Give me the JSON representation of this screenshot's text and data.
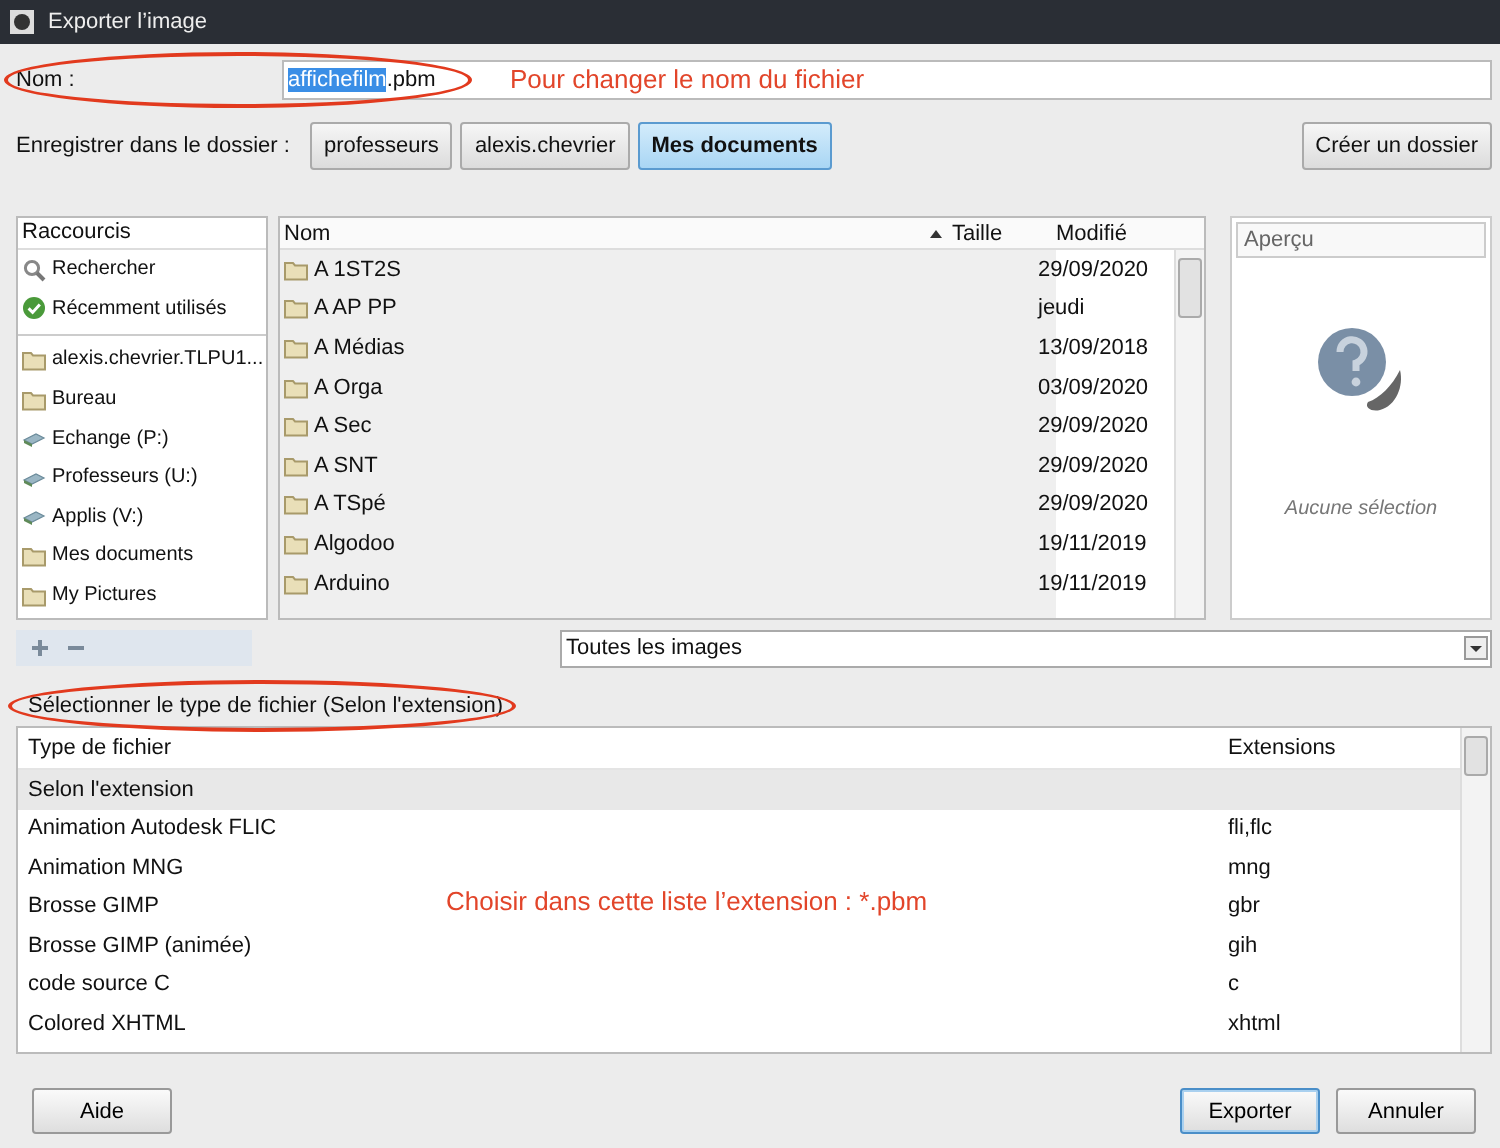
{
  "window": {
    "title": "Exporter l’image"
  },
  "name_field": {
    "label": "Nom :",
    "value_selected": "affichefilm",
    "value_rest": ".pbm",
    "annotation": "Pour changer le nom du fichier"
  },
  "save_in": {
    "label": "Enregistrer dans le dossier :",
    "path": [
      {
        "label": "professeurs",
        "selected": false
      },
      {
        "label": "alexis.chevrier",
        "selected": false
      },
      {
        "label": "Mes documents",
        "selected": true
      }
    ],
    "create_button": "Créer un dossier"
  },
  "sidebar": {
    "header": "Raccourcis",
    "groups": [
      [
        {
          "label": "Rechercher",
          "kind": "search"
        },
        {
          "label": "Récemment utilisés",
          "kind": "recent"
        }
      ],
      [
        {
          "label": "alexis.chevrier.TLPU1...",
          "kind": "folder"
        },
        {
          "label": "Bureau",
          "kind": "folder"
        },
        {
          "label": "Echange (P:)",
          "kind": "drive"
        },
        {
          "label": "Professeurs (U:)",
          "kind": "drive"
        },
        {
          "label": "Applis (V:)",
          "kind": "drive"
        },
        {
          "label": "Mes documents",
          "kind": "folder"
        },
        {
          "label": "My Pictures",
          "kind": "folder"
        }
      ]
    ]
  },
  "files": {
    "columns": [
      "Nom",
      "Taille",
      "Modifié"
    ],
    "rows": [
      {
        "name": "A 1ST2S",
        "modified": "29/09/2020"
      },
      {
        "name": "A AP PP",
        "modified": "jeudi"
      },
      {
        "name": "A Médias",
        "modified": "13/09/2018"
      },
      {
        "name": "A Orga",
        "modified": "03/09/2020"
      },
      {
        "name": "A Sec",
        "modified": "29/09/2020"
      },
      {
        "name": "A SNT",
        "modified": "29/09/2020"
      },
      {
        "name": "A TSpé",
        "modified": "29/09/2020"
      },
      {
        "name": "Algodoo",
        "modified": "19/11/2019"
      },
      {
        "name": "Arduino",
        "modified": "19/11/2019"
      }
    ]
  },
  "preview": {
    "header": "Aperçu",
    "message": "Aucune sélection"
  },
  "filter": {
    "value": "Toutes les images"
  },
  "file_type": {
    "label": "Sélectionner le type de fichier (Selon l'extension)",
    "columns": [
      "Type de fichier",
      "Extensions"
    ],
    "rows": [
      {
        "type": "Selon l'extension",
        "extensions": "",
        "selected": true
      },
      {
        "type": "Animation Autodesk FLIC",
        "extensions": "fli,flc",
        "selected": false
      },
      {
        "type": "Animation MNG",
        "extensions": "mng",
        "selected": false
      },
      {
        "type": "Brosse GIMP",
        "extensions": "gbr",
        "selected": false
      },
      {
        "type": "Brosse GIMP (animée)",
        "extensions": "gih",
        "selected": false
      },
      {
        "type": "code source C",
        "extensions": "c",
        "selected": false
      },
      {
        "type": "Colored XHTML",
        "extensions": "xhtml",
        "selected": false
      }
    ],
    "annotation": "Choisir dans cette liste l’extension : *.pbm"
  },
  "buttons": {
    "help": "Aide",
    "export": "Exporter",
    "cancel": "Annuler"
  }
}
